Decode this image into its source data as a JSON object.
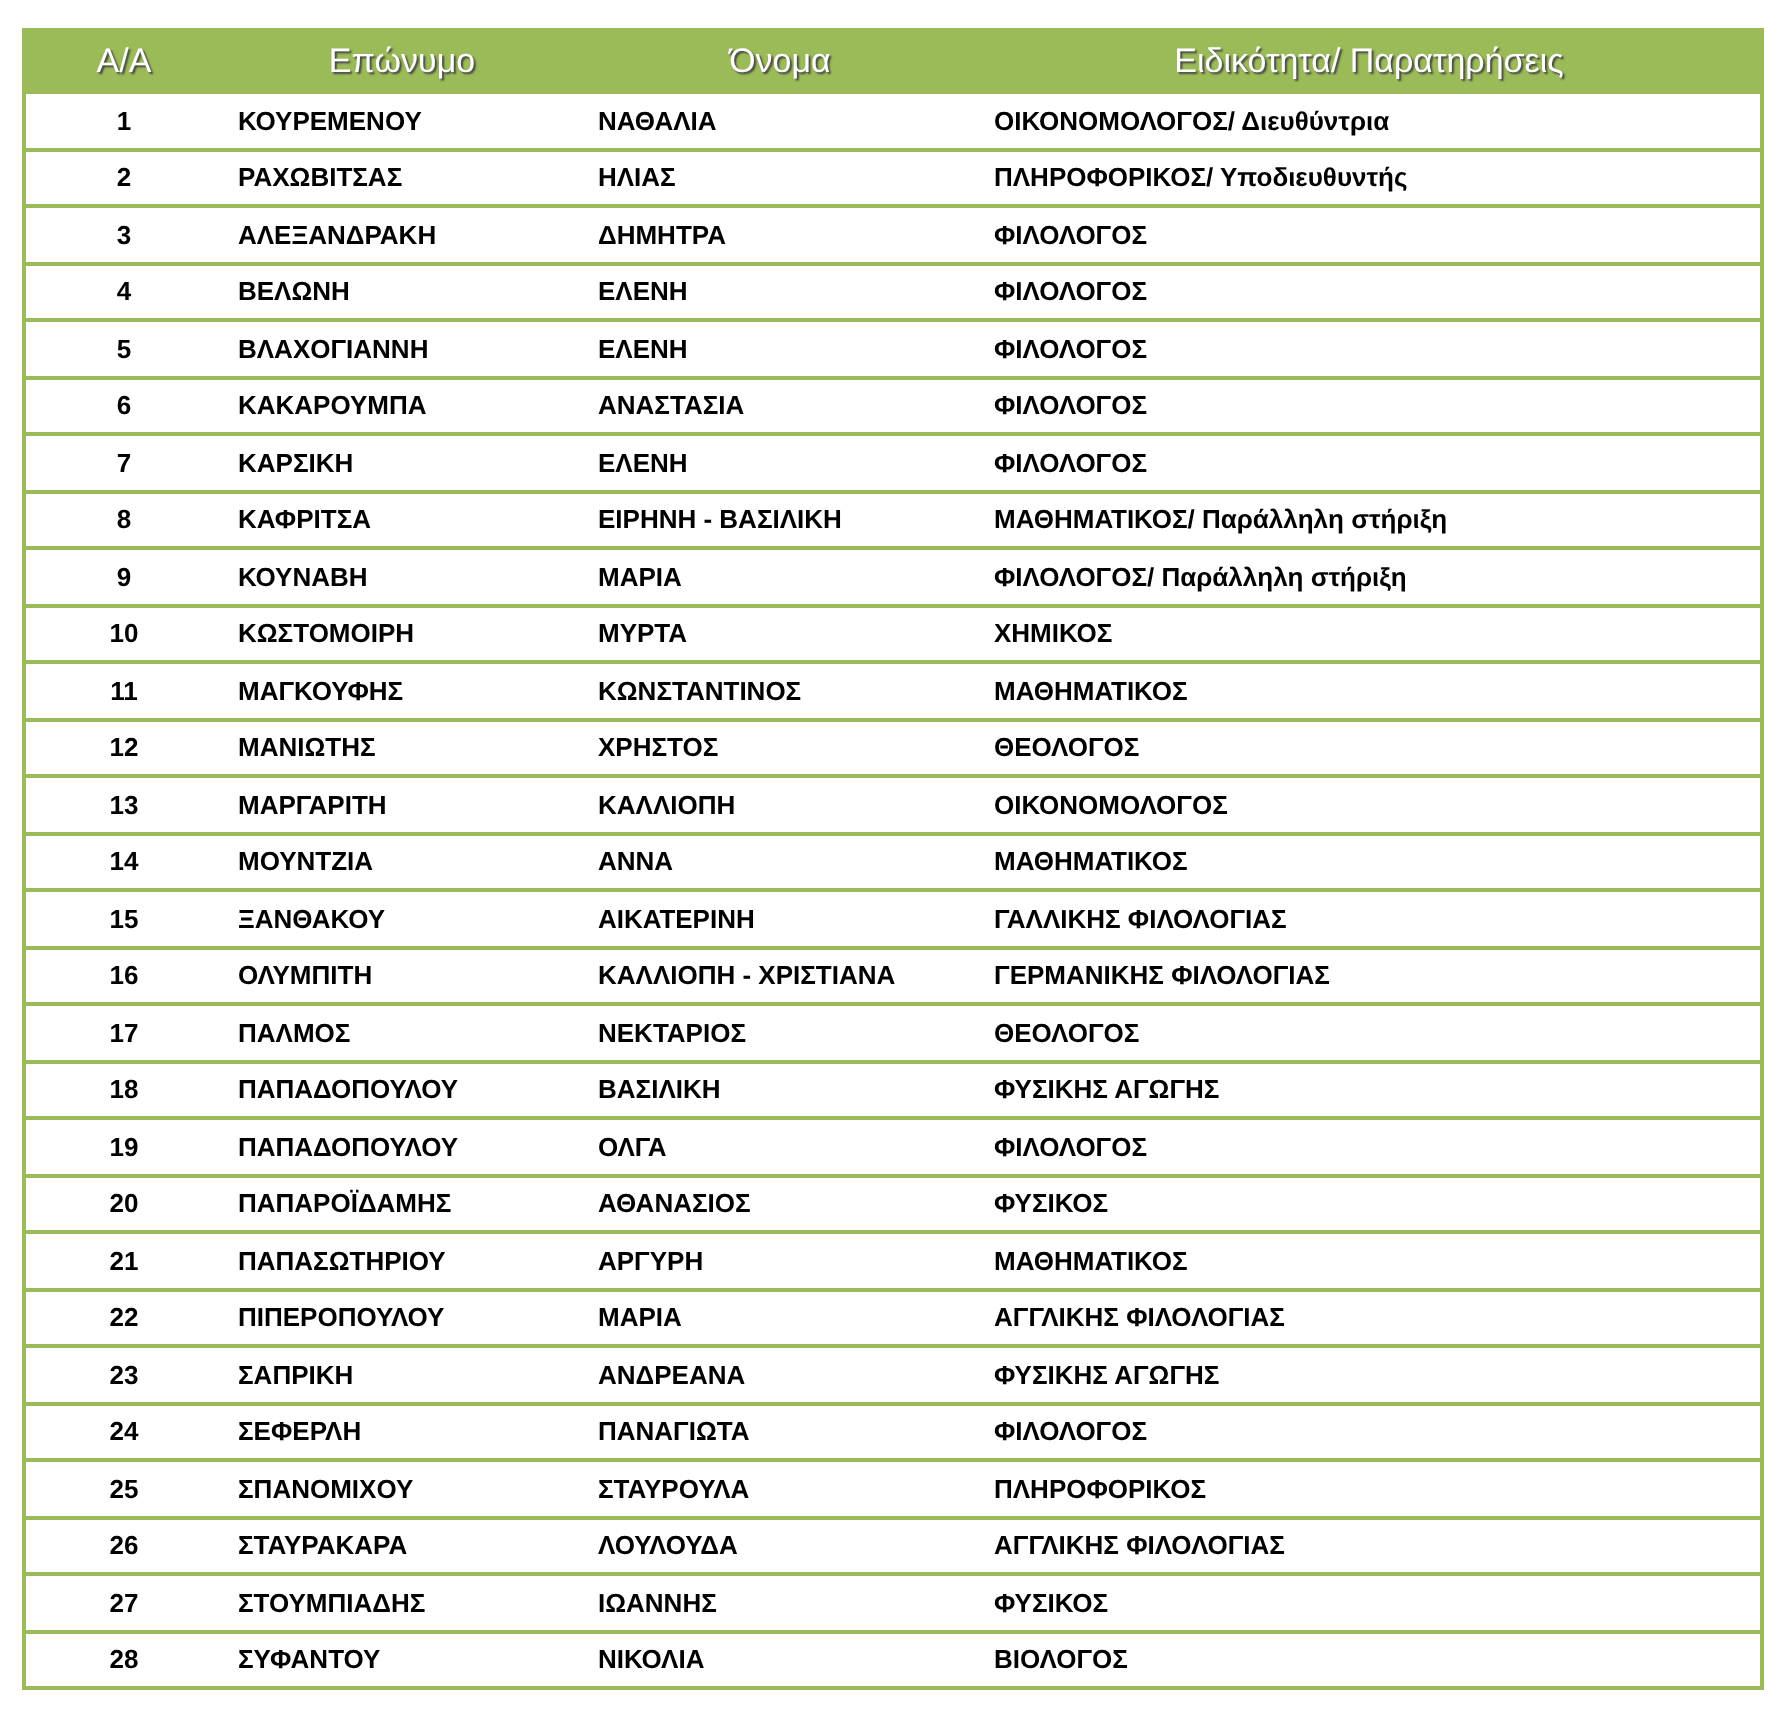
{
  "table": {
    "columns": [
      "Α/Α",
      "Επώνυμο",
      "Όνομα",
      "Ειδικότητα/ Παρατηρήσεις"
    ],
    "rows": [
      [
        "1",
        "ΚΟΥΡΕΜΕΝΟΥ",
        "ΝΑΘΑΛΙΑ",
        "ΟΙΚΟΝΟΜΟΛΟΓΟΣ/ Διευθύντρια"
      ],
      [
        "2",
        "ΡΑΧΩΒΙΤΣΑΣ",
        "ΗΛΙΑΣ",
        "ΠΛΗΡΟΦΟΡΙΚΟΣ/ Υποδιευθυντής"
      ],
      [
        "3",
        "ΑΛΕΞΑΝΔΡΑΚΗ",
        "ΔΗΜΗΤΡΑ",
        "ΦΙΛΟΛΟΓΟΣ"
      ],
      [
        "4",
        "ΒΕΛΩΝΗ",
        "ΕΛΕΝΗ",
        "ΦΙΛΟΛΟΓΟΣ"
      ],
      [
        "5",
        "ΒΛΑΧΟΓΙΑΝΝΗ",
        "ΕΛΕΝΗ",
        "ΦΙΛΟΛΟΓΟΣ"
      ],
      [
        "6",
        "ΚΑΚΑΡΟΥΜΠΑ",
        "ΑΝΑΣΤΑΣΙΑ",
        "ΦΙΛΟΛΟΓΟΣ"
      ],
      [
        "7",
        "ΚΑΡΣΙΚΗ",
        "ΕΛΕΝΗ",
        "ΦΙΛΟΛΟΓΟΣ"
      ],
      [
        "8",
        "ΚΑΦΡΙΤΣΑ",
        "ΕΙΡΗΝΗ - ΒΑΣΙΛΙΚΗ",
        "ΜΑΘΗΜΑΤΙΚΟΣ/ Παράλληλη στήριξη"
      ],
      [
        "9",
        "ΚΟΥΝΑΒΗ",
        "ΜΑΡΙΑ",
        "ΦΙΛΟΛΟΓΟΣ/ Παράλληλη στήριξη"
      ],
      [
        "10",
        "ΚΩΣΤΟΜΟΙΡΗ",
        "ΜΥΡΤΑ",
        "ΧΗΜΙΚΟΣ"
      ],
      [
        "11",
        "ΜΑΓΚΟΥΦΗΣ",
        "ΚΩΝΣΤΑΝΤΙΝΟΣ",
        "ΜΑΘΗΜΑΤΙΚΟΣ"
      ],
      [
        "12",
        "ΜΑΝΙΩΤΗΣ",
        "ΧΡΗΣΤΟΣ",
        "ΘΕΟΛΟΓΟΣ"
      ],
      [
        "13",
        "ΜΑΡΓΑΡΙΤΗ",
        "ΚΑΛΛΙΟΠΗ",
        "ΟΙΚΟΝΟΜΟΛΟΓΟΣ"
      ],
      [
        "14",
        "ΜΟΥΝΤΖΙΑ",
        "ΑΝΝΑ",
        "ΜΑΘΗΜΑΤΙΚΟΣ"
      ],
      [
        "15",
        "ΞΑΝΘΑΚΟΥ",
        "ΑΙΚΑΤΕΡΙΝΗ",
        "ΓΑΛΛΙΚΗΣ ΦΙΛΟΛΟΓΙΑΣ"
      ],
      [
        "16",
        "ΟΛΥΜΠΙΤΗ",
        "ΚΑΛΛΙΟΠΗ - ΧΡΙΣΤΙΑΝΑ",
        "ΓΕΡΜΑΝΙΚΗΣ ΦΙΛΟΛΟΓΙΑΣ"
      ],
      [
        "17",
        "ΠΑΛΜΟΣ",
        "ΝΕΚΤΑΡΙΟΣ",
        "ΘΕΟΛΟΓΟΣ"
      ],
      [
        "18",
        "ΠΑΠΑΔΟΠΟΥΛΟΥ",
        "ΒΑΣΙΛΙΚΗ",
        "ΦΥΣΙΚΗΣ ΑΓΩΓΗΣ"
      ],
      [
        "19",
        "ΠΑΠΑΔΟΠΟΥΛΟΥ",
        "ΟΛΓΑ",
        "ΦΙΛΟΛΟΓΟΣ"
      ],
      [
        "20",
        "ΠΑΠΑΡΟΪΔΑΜΗΣ",
        "ΑΘΑΝΑΣΙΟΣ",
        "ΦΥΣΙΚΟΣ"
      ],
      [
        "21",
        "ΠΑΠΑΣΩΤΗΡΙΟΥ",
        "ΑΡΓΥΡΗ",
        "ΜΑΘΗΜΑΤΙΚΟΣ"
      ],
      [
        "22",
        "ΠΙΠΕΡΟΠΟΥΛΟΥ",
        "ΜΑΡΙΑ",
        "ΑΓΓΛΙΚΗΣ ΦΙΛΟΛΟΓΙΑΣ"
      ],
      [
        "23",
        "ΣΑΠΡΙΚΗ",
        "ΑΝΔΡΕΑΝΑ",
        "ΦΥΣΙΚΗΣ ΑΓΩΓΗΣ"
      ],
      [
        "24",
        "ΣΕΦΕΡΛΗ",
        "ΠΑΝΑΓΙΩΤΑ",
        "ΦΙΛΟΛΟΓΟΣ"
      ],
      [
        "25",
        "ΣΠΑΝΟΜΙΧΟΥ",
        "ΣΤΑΥΡΟΥΛΑ",
        "ΠΛΗΡΟΦΟΡΙΚΟΣ"
      ],
      [
        "26",
        "ΣΤΑΥΡΑΚΑΡΑ",
        "ΛΟΥΛΟΥΔΑ",
        "ΑΓΓΛΙΚΗΣ ΦΙΛΟΛΟΓΙΑΣ"
      ],
      [
        "27",
        "ΣΤΟΥΜΠΙΑΔΗΣ",
        "ΙΩΑΝΝΗΣ",
        "ΦΥΣΙΚΟΣ"
      ],
      [
        "28",
        "ΣΥΦΑΝΤΟΥ",
        "ΝΙΚΟΛΙΑ",
        "ΒΙΟΛΟΓΟΣ"
      ]
    ]
  }
}
